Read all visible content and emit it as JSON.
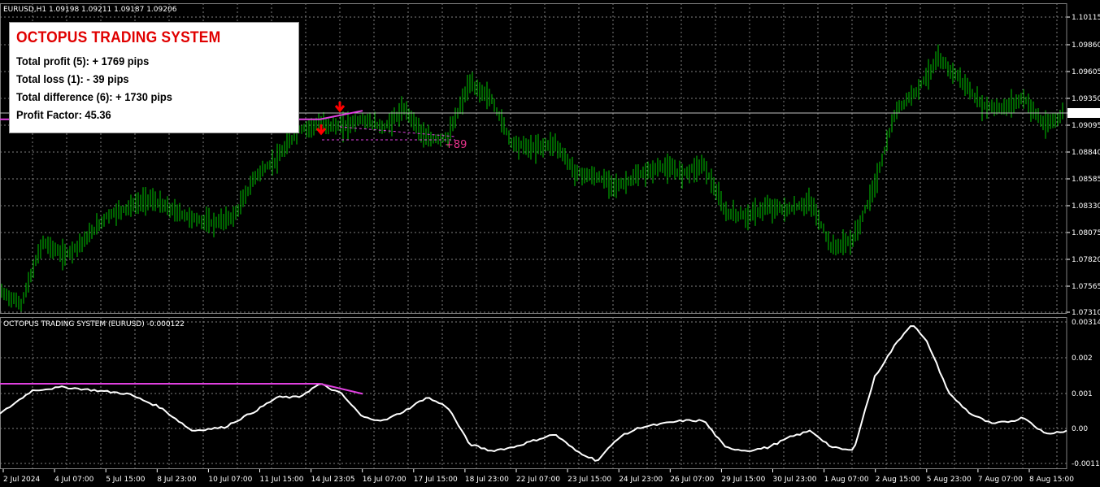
{
  "window": {
    "symbol_title": "EURUSD,H1  1.09198 1.09211 1.09187 1.09206",
    "indicator_title": "OCTOPUS TRADING SYSTEM (EURUSD) -0.000122"
  },
  "info_panel": {
    "title": "OCTOPUS TRADING SYSTEM",
    "lines": [
      "Total profit (5):  + 1769 pips",
      "Total loss (1):  - 39 pips",
      "Total difference (6):  + 1730 pips",
      "Profit Factor:  45.36"
    ]
  },
  "trade_label": "+89",
  "colors": {
    "background": "#000000",
    "bars": "#00c800",
    "grid": "#7f7f7f",
    "indicator_line": "#ffffff",
    "trade_line": "#e040e0",
    "arrow": "#ff0000",
    "price_line": "#c0c0c0"
  },
  "price_axis": {
    "labels": [
      "1.10115",
      "1.09860",
      "1.09605",
      "1.09350",
      "1.09206",
      "1.09095",
      "1.08840",
      "1.08585",
      "1.08330",
      "1.08075",
      "1.07820",
      "1.07565",
      "1.07310"
    ],
    "current_price": "1.09206"
  },
  "indicator_axis": {
    "labels": [
      "0.003144",
      "0.002",
      "0.001",
      "0.00",
      "-0.0011"
    ]
  },
  "time_axis": {
    "labels": [
      "2 Jul 2024",
      "4 Jul 07:00",
      "5 Jul 15:00",
      "8 Jul 23:00",
      "10 Jul 07:00",
      "11 Jul 15:00",
      "14 Jul 23:05",
      "16 Jul 07:00",
      "17 Jul 15:00",
      "18 Jul 23:00",
      "22 Jul 07:00",
      "23 Jul 15:00",
      "24 Jul 23:00",
      "26 Jul 07:00",
      "29 Jul 15:00",
      "30 Jul 23:00",
      "1 Aug 07:00",
      "2 Aug 15:00",
      "5 Aug 23:00",
      "7 Aug 07:00",
      "8 Aug 15:00"
    ]
  },
  "chart_data": {
    "type": "line",
    "title": "EURUSD,H1",
    "price_ylim": [
      1.0731,
      1.102
    ],
    "indicator_ylim": [
      -0.0011,
      0.003144
    ],
    "price_series": [
      {
        "t": 0,
        "p": 1.0752
      },
      {
        "t": 0.02,
        "p": 1.074
      },
      {
        "t": 0.04,
        "p": 1.0798
      },
      {
        "t": 0.06,
        "p": 1.0785
      },
      {
        "t": 0.08,
        "p": 1.08
      },
      {
        "t": 0.1,
        "p": 1.0822
      },
      {
        "t": 0.12,
        "p": 1.083
      },
      {
        "t": 0.14,
        "p": 1.0838
      },
      {
        "t": 0.16,
        "p": 1.0828
      },
      {
        "t": 0.18,
        "p": 1.082
      },
      {
        "t": 0.2,
        "p": 1.0815
      },
      {
        "t": 0.22,
        "p": 1.0822
      },
      {
        "t": 0.24,
        "p": 1.086
      },
      {
        "t": 0.26,
        "p": 1.0875
      },
      {
        "t": 0.28,
        "p": 1.0902
      },
      {
        "t": 0.3,
        "p": 1.0908
      },
      {
        "t": 0.32,
        "p": 1.0905
      },
      {
        "t": 0.34,
        "p": 1.0912
      },
      {
        "t": 0.36,
        "p": 1.0904
      },
      {
        "t": 0.38,
        "p": 1.0922
      },
      {
        "t": 0.4,
        "p": 1.0893
      },
      {
        "t": 0.42,
        "p": 1.0895
      },
      {
        "t": 0.44,
        "p": 1.0945
      },
      {
        "t": 0.46,
        "p": 1.0932
      },
      {
        "t": 0.48,
        "p": 1.089
      },
      {
        "t": 0.5,
        "p": 1.0885
      },
      {
        "t": 0.52,
        "p": 1.089
      },
      {
        "t": 0.54,
        "p": 1.0862
      },
      {
        "t": 0.56,
        "p": 1.0858
      },
      {
        "t": 0.58,
        "p": 1.085
      },
      {
        "t": 0.6,
        "p": 1.086
      },
      {
        "t": 0.62,
        "p": 1.0868
      },
      {
        "t": 0.64,
        "p": 1.0862
      },
      {
        "t": 0.66,
        "p": 1.087
      },
      {
        "t": 0.68,
        "p": 1.0825
      },
      {
        "t": 0.7,
        "p": 1.0822
      },
      {
        "t": 0.72,
        "p": 1.083
      },
      {
        "t": 0.74,
        "p": 1.0828
      },
      {
        "t": 0.76,
        "p": 1.0835
      },
      {
        "t": 0.78,
        "p": 1.0792
      },
      {
        "t": 0.8,
        "p": 1.08
      },
      {
        "t": 0.82,
        "p": 1.085
      },
      {
        "t": 0.84,
        "p": 1.092
      },
      {
        "t": 0.86,
        "p": 1.094
      },
      {
        "t": 0.88,
        "p": 1.0968
      },
      {
        "t": 0.9,
        "p": 1.095
      },
      {
        "t": 0.92,
        "p": 1.0925
      },
      {
        "t": 0.94,
        "p": 1.0922
      },
      {
        "t": 0.96,
        "p": 1.0932
      },
      {
        "t": 0.98,
        "p": 1.0905
      },
      {
        "t": 1,
        "p": 1.092
      }
    ],
    "indicator_series": [
      {
        "t": 0,
        "v": 0.0004
      },
      {
        "t": 0.03,
        "v": 0.0011
      },
      {
        "t": 0.06,
        "v": 0.0012
      },
      {
        "t": 0.09,
        "v": 0.0011
      },
      {
        "t": 0.12,
        "v": 0.001
      },
      {
        "t": 0.15,
        "v": 0.0006
      },
      {
        "t": 0.18,
        "v": -0.0001
      },
      {
        "t": 0.21,
        "v": 0.0
      },
      {
        "t": 0.24,
        "v": 0.0005
      },
      {
        "t": 0.26,
        "v": 0.0009
      },
      {
        "t": 0.28,
        "v": 0.0009
      },
      {
        "t": 0.3,
        "v": 0.0013
      },
      {
        "t": 0.32,
        "v": 0.001
      },
      {
        "t": 0.34,
        "v": 0.0003
      },
      {
        "t": 0.36,
        "v": 0.0002
      },
      {
        "t": 0.38,
        "v": 0.0005
      },
      {
        "t": 0.4,
        "v": 0.0009
      },
      {
        "t": 0.42,
        "v": 0.0006
      },
      {
        "t": 0.44,
        "v": -0.0005
      },
      {
        "t": 0.46,
        "v": -0.0007
      },
      {
        "t": 0.48,
        "v": -0.0006
      },
      {
        "t": 0.5,
        "v": -0.0004
      },
      {
        "t": 0.52,
        "v": -0.0002
      },
      {
        "t": 0.54,
        "v": -0.0007
      },
      {
        "t": 0.56,
        "v": -0.001
      },
      {
        "t": 0.58,
        "v": -0.0003
      },
      {
        "t": 0.6,
        "v": 0.0
      },
      {
        "t": 0.62,
        "v": 0.0001
      },
      {
        "t": 0.64,
        "v": 0.0002
      },
      {
        "t": 0.66,
        "v": 0.0002
      },
      {
        "t": 0.68,
        "v": -0.0006
      },
      {
        "t": 0.7,
        "v": -0.0007
      },
      {
        "t": 0.72,
        "v": -0.0006
      },
      {
        "t": 0.74,
        "v": -0.0003
      },
      {
        "t": 0.76,
        "v": -0.0001
      },
      {
        "t": 0.78,
        "v": -0.0006
      },
      {
        "t": 0.8,
        "v": -0.0007
      },
      {
        "t": 0.82,
        "v": 0.0015
      },
      {
        "t": 0.84,
        "v": 0.0025
      },
      {
        "t": 0.855,
        "v": 0.0031
      },
      {
        "t": 0.87,
        "v": 0.0025
      },
      {
        "t": 0.89,
        "v": 0.001
      },
      {
        "t": 0.91,
        "v": 0.0004
      },
      {
        "t": 0.93,
        "v": 0.0001
      },
      {
        "t": 0.95,
        "v": 0.0002
      },
      {
        "t": 0.96,
        "v": 0.0003
      },
      {
        "t": 0.98,
        "v": -0.0002
      },
      {
        "t": 1,
        "v": -0.0001
      }
    ],
    "trade_levels": {
      "price_line": [
        {
          "t": 0,
          "p": 1.0912
        },
        {
          "t": 0.3,
          "p": 1.0912
        },
        {
          "t": 0.34,
          "p": 1.092
        }
      ],
      "indicator_line": [
        {
          "t": 0,
          "v": 0.0013
        },
        {
          "t": 0.3,
          "v": 0.0013
        },
        {
          "t": 0.34,
          "v": 0.001
        }
      ]
    }
  }
}
